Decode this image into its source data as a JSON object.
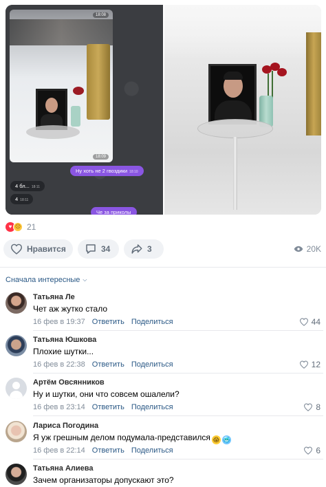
{
  "post": {
    "screenshot": {
      "messages": [
        {
          "text": "Ну хоть не 2 гвоздики",
          "time": "18:10",
          "direction": "out"
        },
        {
          "text": "4 бл...",
          "time": "18:11",
          "direction": "in"
        },
        {
          "text": "4",
          "time": "18:11",
          "direction": "in"
        },
        {
          "text": "Че за приколы",
          "time": "",
          "direction": "out"
        }
      ],
      "photo_times": [
        "18:08",
        "18:09"
      ]
    },
    "reactions": {
      "icons": [
        "heart-icon",
        "sad-face-icon"
      ],
      "count": "21"
    },
    "actions": {
      "like_label": "Нравится",
      "comments_count": "34",
      "shares_count": "3",
      "views": "20K"
    }
  },
  "comments_section": {
    "sort_label": "Сначала интересные",
    "comments": [
      {
        "author": "Татьяна Ле",
        "text": "Чет аж жутко стало",
        "date": "16 фев в 19:37",
        "reply_label": "Ответить",
        "share_label": "Поделиться",
        "likes": "44"
      },
      {
        "author": "Татьяна Юшкова",
        "text": "Плохие шутки...",
        "date": "16 фев в 22:38",
        "reply_label": "Ответить",
        "share_label": "Поделиться",
        "likes": "12"
      },
      {
        "author": "Артём Овсянников",
        "text": "Ну и шутки, они что совсем ошалели?",
        "date": "16 фев в 23:14",
        "reply_label": "Ответить",
        "share_label": "Поделиться",
        "likes": "8"
      },
      {
        "author": "Лариса Погодина",
        "text": "Я уж грешным делом подумала-представился",
        "emojis": [
          "screaming-face-icon",
          "cold-face-icon"
        ],
        "date": "16 фев в 22:14",
        "reply_label": "Ответить",
        "share_label": "Поделиться",
        "likes": "6"
      },
      {
        "author": "Татьяна Алиева",
        "text": "Зачем организаторы допускают это?"
      }
    ]
  },
  "colors": {
    "link": "#2a5885",
    "muted": "#818c99",
    "button_bg": "#f0f2f5",
    "reaction_heart": "#ff3347",
    "telegram_bubble": "#8a56e2"
  }
}
